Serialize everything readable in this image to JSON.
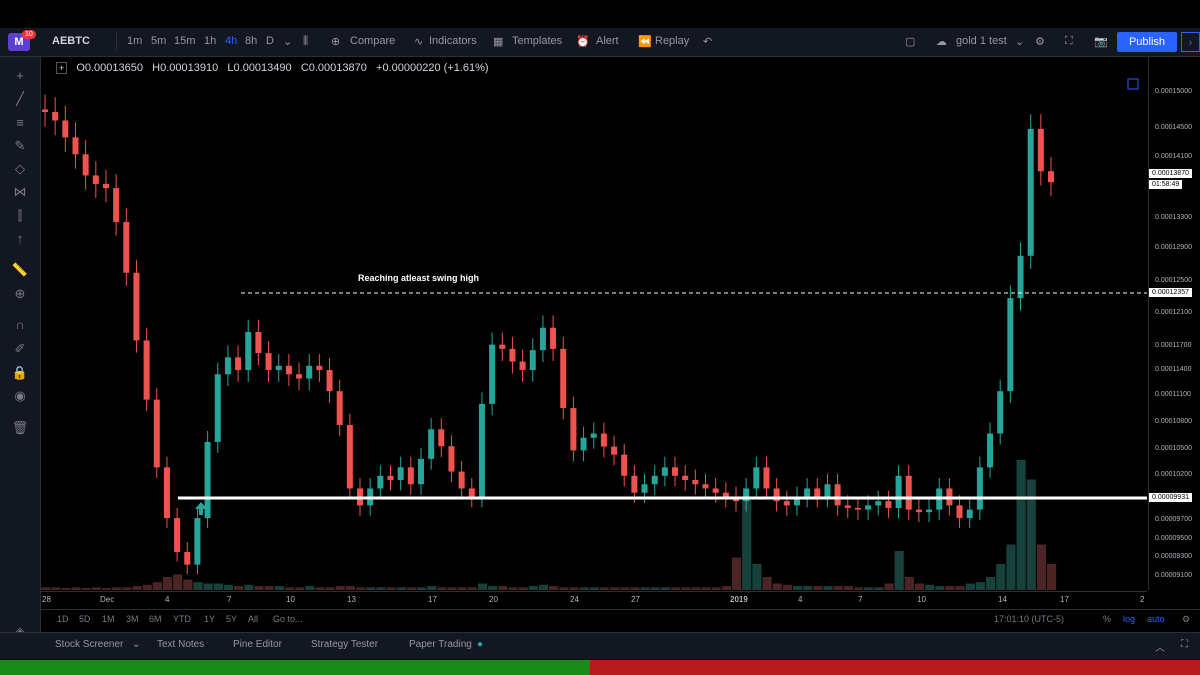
{
  "app": {
    "badge": "10",
    "logo": "M"
  },
  "toolbar": {
    "symbol": "AEBTC",
    "intervals": [
      "1m",
      "5m",
      "15m",
      "1h",
      "4h",
      "8h",
      "D"
    ],
    "active_interval": "4h",
    "compare_label": "Compare",
    "indicators_label": "Indicators",
    "templates_label": "Templates",
    "alert_label": "Alert",
    "replay_label": "Replay",
    "layout_name": "gold 1 test",
    "publish_label": "Publish"
  },
  "legend": {
    "open": "O0.00013650",
    "high": "H0.00013910",
    "low": "L0.00013490",
    "close": "C0.00013870",
    "change": "+0.00000220 (+1.61%)"
  },
  "annotation": {
    "text": "Reaching atleast swing high"
  },
  "chart_data": {
    "type": "candlestick",
    "symbol": "AEBTC",
    "interval": "4h",
    "x_tick_labels": [
      "28",
      "Dec",
      "4",
      "7",
      "10",
      "13",
      "17",
      "20",
      "24",
      "27",
      "2019",
      "4",
      "7",
      "10",
      "14",
      "17",
      "2"
    ],
    "y_tick_labels": [
      "0.00015000",
      "0.00014500",
      "0.00014100",
      "0.00013870",
      "0.00013300",
      "0.00012900",
      "0.00012500",
      "0.00012357",
      "0.00012100",
      "0.00011700",
      "0.00011400",
      "0.00011100",
      "0.00010800",
      "0.00010500",
      "0.00010200",
      "0.00009931",
      "0.00009700",
      "0.00009500",
      "0.00009300",
      "0.00009100"
    ],
    "ylim": [
      9.05e-05,
      0.0001535
    ],
    "current_price": "0.00013870",
    "countdown": "01:58:49",
    "resistance_level": "0.00012357",
    "support_level": "0.00009931",
    "closes": [
      0.000147,
      0.000146,
      0.000144,
      0.000142,
      0.0001395,
      0.0001385,
      0.000138,
      0.000134,
      0.000128,
      0.00012,
      0.000113,
      0.000105,
      9.9e-05,
      9.5e-05,
      9.35e-05,
      9.9e-05,
      0.000108,
      0.000116,
      0.000118,
      0.0001165,
      0.000121,
      0.0001185,
      0.0001165,
      0.000117,
      0.000116,
      0.0001155,
      0.000117,
      0.0001165,
      0.000114,
      0.00011,
      0.0001025,
      0.0001005,
      0.0001025,
      0.000104,
      0.0001035,
      0.000105,
      0.000103,
      0.000106,
      0.0001095,
      0.0001075,
      0.0001045,
      0.0001025,
      0.0001015,
      0.0001125,
      0.0001195,
      0.000119,
      0.0001175,
      0.0001165,
      0.00011885,
      0.0001215,
      0.000119,
      0.000112,
      0.000107,
      0.0001085,
      0.000109,
      0.00010745,
      0.0001065,
      0.000104,
      0.000102,
      0.000103,
      0.000104,
      0.000105,
      0.000104,
      0.0001035,
      0.000103,
      0.0001025,
      0.000102,
      0.0001015,
      0.000101,
      0.0001025,
      0.000105,
      0.0001025,
      0.000101,
      0.0001005,
      0.0001015,
      0.0001025,
      0.0001015,
      0.000103,
      0.0001005,
      0.0001002,
      0.0001,
      0.0001005,
      0.000101,
      0.0001002,
      0.000104,
      0.0001,
      9.97e-05,
      0.0001,
      0.0001025,
      0.0001005,
      9.9e-05,
      0.0001,
      0.000105,
      0.000109,
      0.000114,
      0.000125,
      0.00013,
      0.000145,
      0.00014,
      0.0001387
    ],
    "volume": [
      0.02,
      0.02,
      0.015,
      0.02,
      0.015,
      0.02,
      0.015,
      0.02,
      0.02,
      0.03,
      0.04,
      0.06,
      0.1,
      0.12,
      0.08,
      0.06,
      0.05,
      0.05,
      0.04,
      0.03,
      0.04,
      0.03,
      0.03,
      0.03,
      0.02,
      0.02,
      0.03,
      0.02,
      0.02,
      0.03,
      0.03,
      0.02,
      0.02,
      0.02,
      0.02,
      0.02,
      0.02,
      0.02,
      0.03,
      0.02,
      0.02,
      0.02,
      0.02,
      0.05,
      0.03,
      0.03,
      0.02,
      0.02,
      0.03,
      0.04,
      0.03,
      0.02,
      0.02,
      0.02,
      0.02,
      0.02,
      0.02,
      0.02,
      0.02,
      0.02,
      0.02,
      0.02,
      0.02,
      0.02,
      0.02,
      0.02,
      0.02,
      0.03,
      0.25,
      0.7,
      0.2,
      0.1,
      0.05,
      0.04,
      0.03,
      0.03,
      0.03,
      0.03,
      0.03,
      0.03,
      0.02,
      0.02,
      0.02,
      0.05,
      0.3,
      0.1,
      0.05,
      0.04,
      0.03,
      0.03,
      0.03,
      0.05,
      0.06,
      0.1,
      0.2,
      0.35,
      1.0,
      0.85,
      0.35,
      0.2
    ],
    "grid": false
  },
  "timescale": {
    "clock": "17:01:10 (UTC-5)"
  },
  "range_buttons": [
    "1D",
    "5D",
    "1M",
    "3M",
    "6M",
    "YTD",
    "1Y",
    "5Y",
    "All"
  ],
  "goto_label": "Go to...",
  "scale_options": {
    "percent": "%",
    "log": "log",
    "auto": "auto"
  },
  "bottom_tabs": [
    "Stock Screener",
    "Text Notes",
    "Pine Editor",
    "Strategy Tester",
    "Paper Trading"
  ],
  "colors": {
    "up": "#26a69a",
    "down": "#ef5350",
    "accent": "#2962ff",
    "bg": "#000000",
    "panel": "#131722"
  }
}
